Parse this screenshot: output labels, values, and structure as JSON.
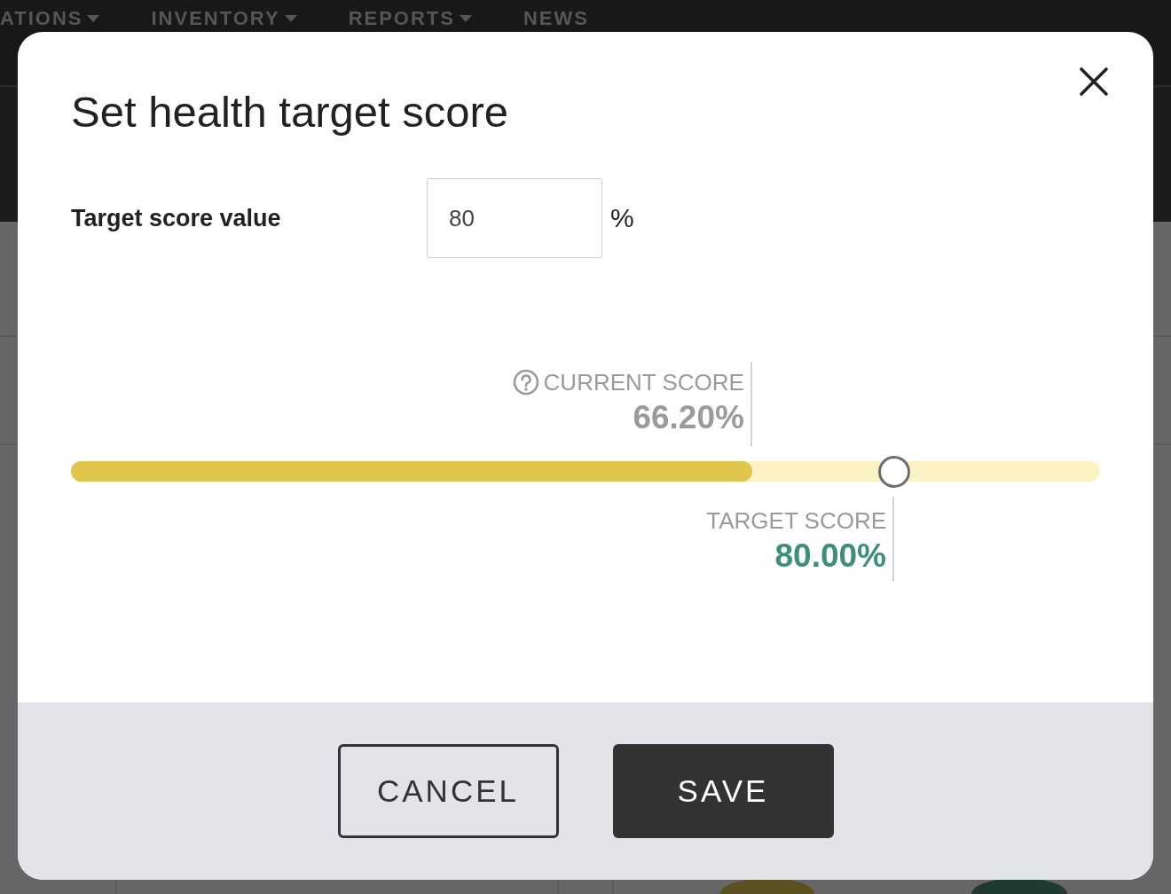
{
  "navbar": {
    "items": [
      {
        "label": "ATIONS",
        "dropdown": true
      },
      {
        "label": "INVENTORY",
        "dropdown": true
      },
      {
        "label": "REPORTS",
        "dropdown": true
      },
      {
        "label": "NEWS",
        "dropdown": false
      }
    ]
  },
  "dialog": {
    "title": "Set health target score",
    "field": {
      "label": "Target score value",
      "value": "80",
      "unit": "%"
    },
    "score_track": {
      "current": {
        "label": "CURRENT SCORE",
        "value": "66.20%",
        "level": 0.662
      },
      "target": {
        "label": "TARGET SCORE",
        "value": "80.00%",
        "level": 0.8
      }
    },
    "buttons": [
      {
        "label": "CANCEL",
        "kind": "secondary"
      },
      {
        "label": "SAVE",
        "kind": "primary"
      }
    ]
  }
}
